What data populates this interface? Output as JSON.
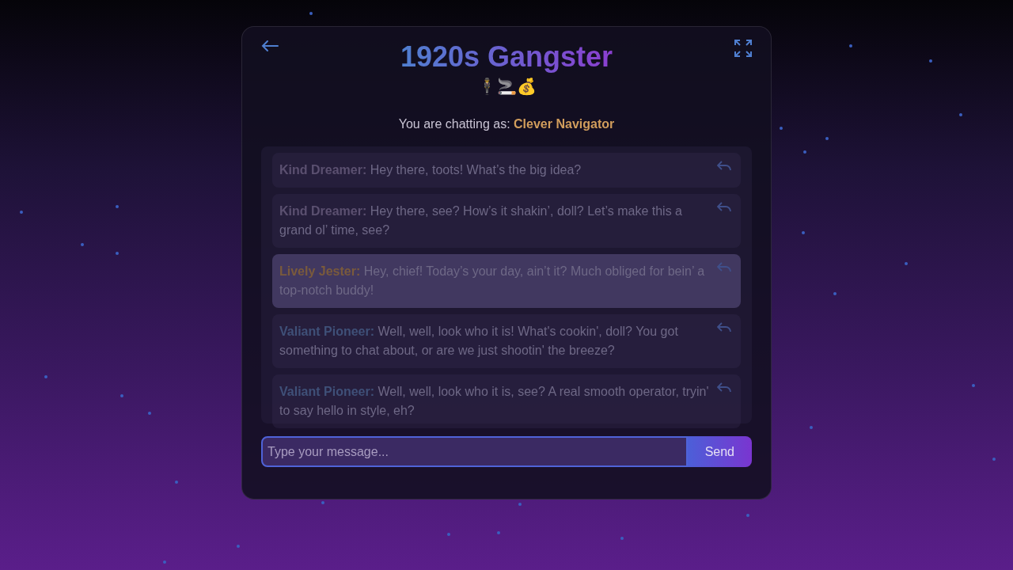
{
  "header": {
    "title": "1920s Gangster",
    "emojis": "🕴️🚬💰"
  },
  "identity": {
    "label": "You are chatting as:",
    "name": "Clever Navigator"
  },
  "messages": [
    {
      "author": "Kind Dreamer:",
      "color": "#5b5070",
      "text": "Hey there, toots! What’s the big idea?",
      "selected": false
    },
    {
      "author": "Kind Dreamer:",
      "color": "#5b5070",
      "text": "Hey there, see? How’s it shakin’, doll? Let’s make this a grand ol’ time, see?",
      "selected": false
    },
    {
      "author": "Lively Jester:",
      "color": "#7a5a3c",
      "text": "Hey, chief! Today’s your day, ain’t it? Much obliged for bein’ a top-notch buddy!",
      "selected": true
    },
    {
      "author": "Valiant Pioneer:",
      "color": "#3f5078",
      "text": "Well, well, look who it is! What's cookin', doll? You got something to chat about, or are we just shootin' the breeze?",
      "selected": false
    },
    {
      "author": "Valiant Pioneer:",
      "color": "#3f5078",
      "text": "Well, well, look who it is, see? A real smooth operator, tryin' to say hello in style, eh?",
      "selected": false
    }
  ],
  "composer": {
    "placeholder": "Type your message...",
    "button": "Send"
  }
}
